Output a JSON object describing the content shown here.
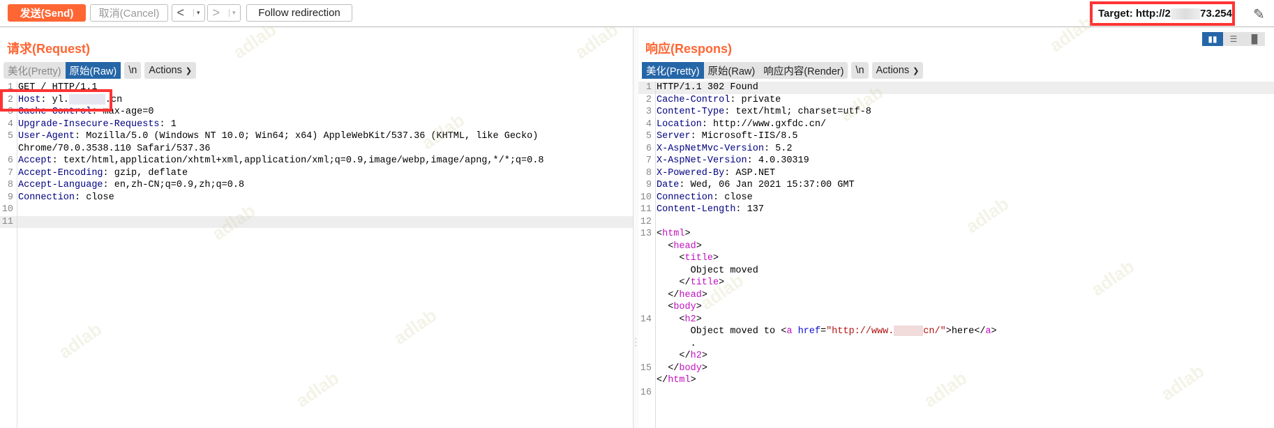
{
  "toolbar": {
    "send": "发送(Send)",
    "cancel": "取消(Cancel)",
    "back": "<",
    "forward": ">",
    "dropdown": "▾",
    "follow": "Follow redirection",
    "target_prefix": "Target: http://2",
    "target_suffix": "73.254",
    "edit_icon": "pencil-icon"
  },
  "request": {
    "title": "请求(Request)",
    "tabs": [
      "美化(Pretty)",
      "原始(Raw)"
    ],
    "newline": "\\n",
    "actions": "Actions",
    "lines": [
      {
        "n": "1",
        "k": "",
        "v": "GET / HTTP/1.1"
      },
      {
        "n": "2",
        "k": "Host",
        "v": ": yl.",
        "v2": ".cn"
      },
      {
        "n": "3",
        "k": "Cache-Control",
        "v": ": max-age=0"
      },
      {
        "n": "4",
        "k": "Upgrade-Insecure-Requests",
        "v": ": 1"
      },
      {
        "n": "5",
        "k": "User-Agent",
        "v": ": Mozilla/5.0 (Windows NT 10.0; Win64; x64) AppleWebKit/537.36 (KHTML, like Gecko)"
      },
      {
        "n": "",
        "k": "",
        "v": "Chrome/70.0.3538.110 Safari/537.36"
      },
      {
        "n": "6",
        "k": "Accept",
        "v": ": text/html,application/xhtml+xml,application/xml;q=0.9,image/webp,image/apng,*/*;q=0.8"
      },
      {
        "n": "7",
        "k": "Accept-Encoding",
        "v": ": gzip, deflate"
      },
      {
        "n": "8",
        "k": "Accept-Language",
        "v": ": en,zh-CN;q=0.9,zh;q=0.8"
      },
      {
        "n": "9",
        "k": "Connection",
        "v": ": close"
      },
      {
        "n": "10",
        "k": "",
        "v": ""
      },
      {
        "n": "11",
        "k": "",
        "v": ""
      }
    ]
  },
  "response": {
    "title": "响应(Respons)",
    "tabs": [
      "美化(Pretty)",
      "原始(Raw)",
      "响应内容(Render)"
    ],
    "newline": "\\n",
    "actions": "Actions",
    "headers": [
      {
        "n": "1",
        "k": "",
        "v": "HTTP/1.1 302 Found"
      },
      {
        "n": "2",
        "k": "Cache-Control",
        "v": ": private"
      },
      {
        "n": "3",
        "k": "Content-Type",
        "v": ": text/html; charset=utf-8"
      },
      {
        "n": "4",
        "k": "Location",
        "v": ": http://www.gxfdc.cn/"
      },
      {
        "n": "5",
        "k": "Server",
        "v": ": Microsoft-IIS/8.5"
      },
      {
        "n": "6",
        "k": "X-AspNetMvc-Version",
        "v": ": 5.2"
      },
      {
        "n": "7",
        "k": "X-AspNet-Version",
        "v": ": 4.0.30319"
      },
      {
        "n": "8",
        "k": "X-Powered-By",
        "v": ": ASP.NET"
      },
      {
        "n": "9",
        "k": "Date",
        "v": ": Wed, 06 Jan 2021 15:37:00 GMT"
      },
      {
        "n": "10",
        "k": "Connection",
        "v": ": close"
      },
      {
        "n": "11",
        "k": "Content-Length",
        "v": ": 137"
      },
      {
        "n": "12",
        "k": "",
        "v": ""
      }
    ],
    "body": {
      "html": "html",
      "head": "head",
      "title": "title",
      "title_text": "Object moved",
      "body": "body",
      "h2": "h2",
      "moved": "Object moved to ",
      "a": "a",
      "href": "href",
      "href_pre": "\"http://www.",
      "href_post": "cn/\"",
      "here": "here",
      "dot": ".",
      "ln13": "13",
      "ln14": "14",
      "ln15": "15",
      "ln16": "16"
    }
  },
  "view_toggle": [
    "split-horizontal-icon",
    "split-vertical-icon",
    "single-pane-icon"
  ],
  "watermark": "adlab",
  "colors": {
    "accent": "#ff6633",
    "active_tab": "#2566a7",
    "header_key": "#000080",
    "tag": "#c010c0",
    "attr": "#1010d0",
    "string": "#b01010",
    "highlight_box": "#ff3333"
  }
}
